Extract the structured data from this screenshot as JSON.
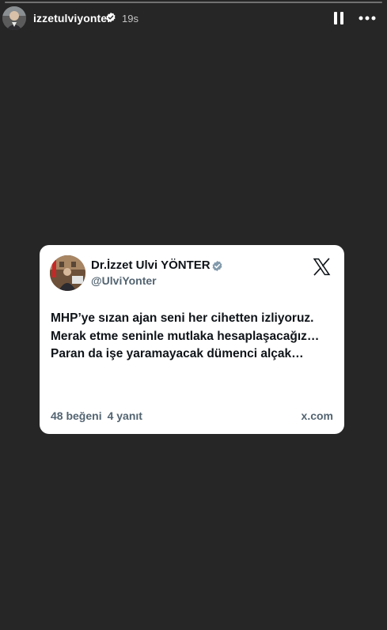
{
  "story": {
    "progress_fraction": 0.0,
    "username": "izzetulviyonter",
    "time_ago": "19s"
  },
  "tweet": {
    "display_name": "Dr.İzzet Ulvi YÖNTER",
    "handle": "@UlviYonter",
    "text": "MHP’ye sızan ajan seni her cihetten izliyoruz. Merak etme seninle mutlaka hesaplaşacağız…Paran da işe yaramayacak dümenci alçak…",
    "likes": "48 beğeni",
    "replies": "4 yanıt",
    "domain": "x.com"
  },
  "icons": {
    "verified": "verified-badge-icon",
    "pause": "pause-icon",
    "more": "more-options-icon",
    "x_logo": "x-logo-icon"
  },
  "colors": {
    "background": "#262626",
    "card": "#ffffff",
    "verified_header": "#ffffff",
    "verified_card": "#829aab",
    "secondary_text": "#536471"
  }
}
